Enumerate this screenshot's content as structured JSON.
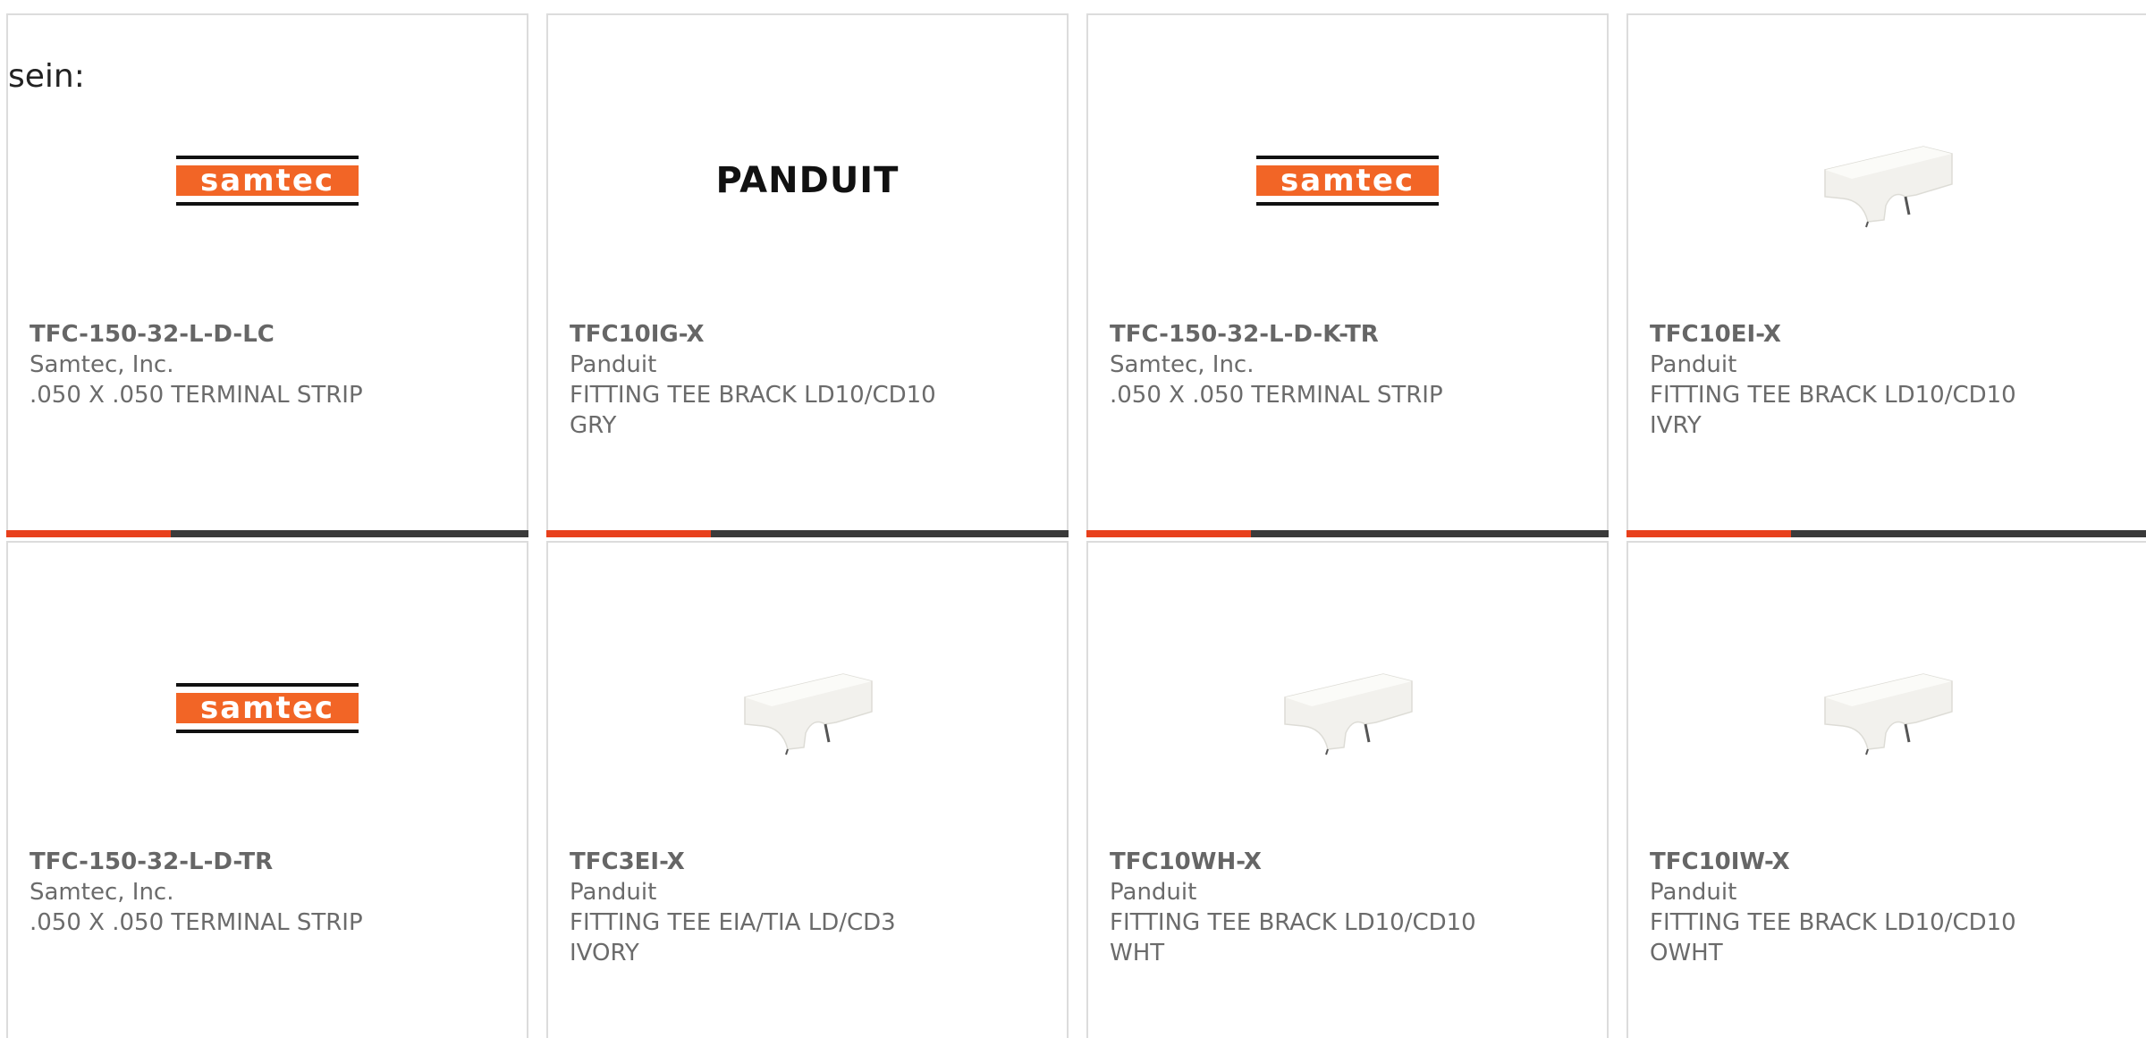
{
  "intro_text": "sein:",
  "colors": {
    "accent": "#e8401c",
    "bar_dark": "#3a3a3a",
    "samtec_orange": "#f26526",
    "border": "#dcdcdc",
    "text": "#666666"
  },
  "cards": [
    {
      "image": "samtec-logo",
      "logo_text": "samtec",
      "part": "TFC-150-32-L-D-LC",
      "manufacturer": "Samtec, Inc.",
      "description": ".050 X .050 TERMINAL STRIP"
    },
    {
      "image": "panduit-logo",
      "logo_text": "PANDUIT",
      "part": "TFC10IG-X",
      "manufacturer": "Panduit",
      "description": "FITTING TEE BRACK LD10/CD10 GRY"
    },
    {
      "image": "samtec-logo",
      "logo_text": "samtec",
      "part": "TFC-150-32-L-D-K-TR",
      "manufacturer": "Samtec, Inc.",
      "description": ".050 X .050 TERMINAL STRIP"
    },
    {
      "image": "tee-fitting-image",
      "part": "TFC10EI-X",
      "manufacturer": "Panduit",
      "description": "FITTING TEE BRACK LD10/CD10 IVRY"
    },
    {
      "image": "samtec-logo",
      "logo_text": "samtec",
      "part": "TFC-150-32-L-D-TR",
      "manufacturer": "Samtec, Inc.",
      "description": ".050 X .050 TERMINAL STRIP"
    },
    {
      "image": "tee-fitting-image",
      "part": "TFC3EI-X",
      "manufacturer": "Panduit",
      "description": "FITTING TEE EIA/TIA LD/CD3 IVORY"
    },
    {
      "image": "tee-fitting-image",
      "part": "TFC10WH-X",
      "manufacturer": "Panduit",
      "description": "FITTING TEE BRACK LD10/CD10 WHT"
    },
    {
      "image": "tee-fitting-image",
      "part": "TFC10IW-X",
      "manufacturer": "Panduit",
      "description": "FITTING TEE BRACK LD10/CD10 OWHT"
    }
  ]
}
